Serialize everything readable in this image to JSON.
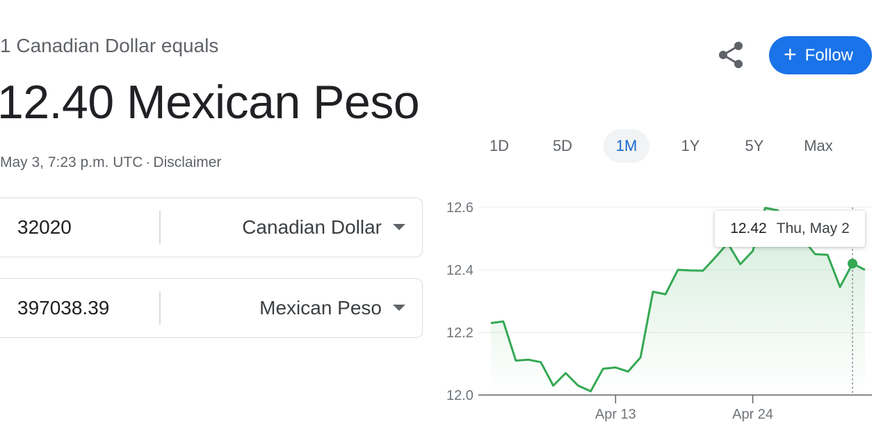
{
  "header": {
    "subtitle": "1 Canadian Dollar equals",
    "headline": "12.40 Mexican Peso",
    "timestamp": "May 3, 7:23 p.m. UTC",
    "separator": "·",
    "disclaimer": "Disclaimer"
  },
  "actions": {
    "share_icon": "share-icon",
    "follow_label": "Follow",
    "follow_icon": "+",
    "follow_color": "#1a73e8"
  },
  "converter": {
    "from": {
      "amount": "32020",
      "currency": "Canadian Dollar"
    },
    "to": {
      "amount": "397038.39",
      "currency": "Mexican Peso"
    }
  },
  "ranges": {
    "items": [
      "1D",
      "5D",
      "1M",
      "1Y",
      "5Y",
      "Max"
    ],
    "selected": "1M"
  },
  "tooltip": {
    "value": "12.42",
    "date": "Thu, May 2"
  },
  "chart_data": {
    "type": "area",
    "line_color": "#34a853",
    "ylim": [
      12.0,
      12.6
    ],
    "y_ticks": [
      12.0,
      12.2,
      12.4,
      12.6
    ],
    "y_tick_labels": [
      "12.0",
      "12.2",
      "12.4",
      "12.6"
    ],
    "x_ticks": [
      {
        "label": "Apr 13",
        "at": "2024-04-13"
      },
      {
        "label": "Apr 24",
        "at": "2024-04-24"
      }
    ],
    "grid": true,
    "highlight_date": "2024-05-02",
    "series": [
      {
        "points": [
          [
            "2024-04-03",
            12.23
          ],
          [
            "2024-04-04",
            12.235
          ],
          [
            "2024-04-05",
            12.11
          ],
          [
            "2024-04-06",
            12.113
          ],
          [
            "2024-04-07",
            12.105
          ],
          [
            "2024-04-08",
            12.03
          ],
          [
            "2024-04-09",
            12.07
          ],
          [
            "2024-04-10",
            12.03
          ],
          [
            "2024-04-11",
            12.012
          ],
          [
            "2024-04-12",
            12.084
          ],
          [
            "2024-04-13",
            12.088
          ],
          [
            "2024-04-14",
            12.075
          ],
          [
            "2024-04-15",
            12.12
          ],
          [
            "2024-04-16",
            12.33
          ],
          [
            "2024-04-17",
            12.322
          ],
          [
            "2024-04-18",
            12.4
          ],
          [
            "2024-04-19",
            12.398
          ],
          [
            "2024-04-20",
            12.397
          ],
          [
            "2024-04-21",
            12.44
          ],
          [
            "2024-04-22",
            12.485
          ],
          [
            "2024-04-23",
            12.418
          ],
          [
            "2024-04-24",
            12.46
          ],
          [
            "2024-04-25",
            12.598
          ],
          [
            "2024-04-26",
            12.59
          ],
          [
            "2024-04-27",
            12.55
          ],
          [
            "2024-04-28",
            12.5
          ],
          [
            "2024-04-29",
            12.45
          ],
          [
            "2024-04-30",
            12.448
          ],
          [
            "2024-05-01",
            12.345
          ],
          [
            "2024-05-02",
            12.42
          ],
          [
            "2024-05-03",
            12.4
          ]
        ]
      }
    ]
  }
}
